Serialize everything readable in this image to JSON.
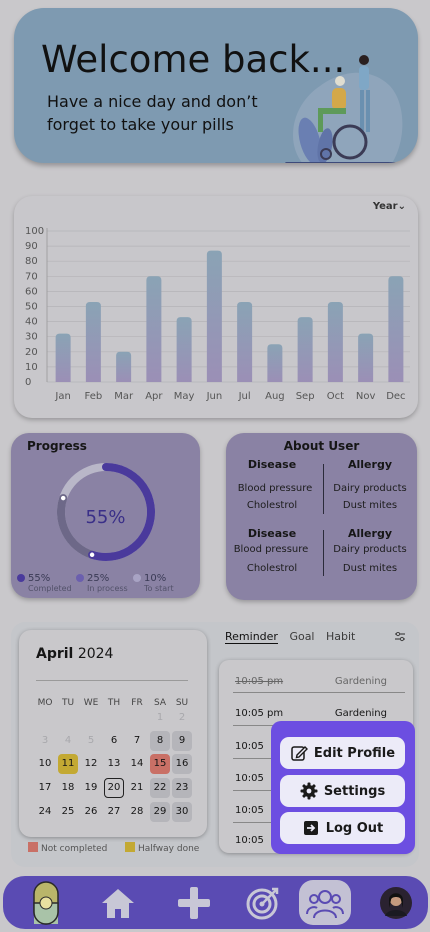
{
  "welcome": {
    "title": "Welcome back...",
    "subtitle": "Have a nice day and don’t forget to take your pills"
  },
  "chart": {
    "period_select": "Year",
    "period_select_icon": "chevron-down-icon"
  },
  "chart_data": {
    "type": "bar",
    "title": "",
    "xlabel": "",
    "ylabel": "",
    "categories": [
      "Jan",
      "Feb",
      "Mar",
      "Apr",
      "May",
      "Jun",
      "Jul",
      "Aug",
      "Sep",
      "Oct",
      "Nov",
      "Dec"
    ],
    "values": [
      32,
      53,
      20,
      70,
      43,
      87,
      53,
      25,
      43,
      53,
      32,
      70
    ],
    "ylim": [
      0,
      100
    ],
    "yticks": [
      0,
      10,
      20,
      30,
      40,
      50,
      60,
      70,
      80,
      90,
      100
    ],
    "grid": true,
    "bar_color_top": "#8aa3b5",
    "bar_color_bottom": "#9b8fb6"
  },
  "progress": {
    "title": "Progress",
    "percent_label": "55%",
    "completed_fraction": 0.55,
    "in_process_fraction": 0.25,
    "legend": [
      {
        "value": "55%",
        "label": "Completed",
        "color": "#4a3a9c"
      },
      {
        "value": "25%",
        "label": "In process",
        "color": "#6b5fae"
      },
      {
        "value": "10%",
        "label": "To start",
        "color": "#a8a3c4"
      }
    ]
  },
  "about": {
    "title": "About User",
    "disease_header": "Disease",
    "allergy_header": "Allergy",
    "groups": [
      {
        "disease": [
          "Blood pressure",
          "Cholestrol"
        ],
        "allergy": [
          "Dairy products",
          "Dust mites"
        ]
      },
      {
        "disease": [
          "Blood pressure",
          "Cholestrol"
        ],
        "allergy": [
          "Dairy products",
          "Dust mites"
        ]
      }
    ]
  },
  "calendar": {
    "month": "April",
    "year": "2024",
    "weekdays": [
      "MO",
      "TU",
      "WE",
      "TH",
      "FR",
      "SA",
      "SU"
    ],
    "weeks": [
      [
        "",
        "",
        "",
        "",
        "",
        "1",
        "2"
      ],
      [
        "3",
        "4",
        "5",
        "6",
        "7",
        "8",
        "9"
      ],
      [
        "10",
        "11",
        "12",
        "13",
        "14",
        "15",
        "16"
      ],
      [
        "17",
        "18",
        "19",
        "20",
        "21",
        "22",
        "23"
      ],
      [
        "24",
        "25",
        "26",
        "27",
        "28",
        "29",
        "30"
      ]
    ],
    "legend": [
      {
        "label": "Not completed",
        "color": "#c97066"
      },
      {
        "label": "Halfway done",
        "color": "#c3a933"
      }
    ]
  },
  "reminders": {
    "tabs": [
      "Reminder",
      "Goal",
      "Habit"
    ],
    "active_tab": "Reminder",
    "filter_icon": "filter-icon",
    "items": [
      {
        "time": "10:05 pm",
        "name": "Gardening",
        "done": true
      },
      {
        "time": "10:05 pm",
        "name": "Gardening",
        "done": false
      },
      {
        "time": "10:05",
        "name": "",
        "done": false
      },
      {
        "time": "10:05",
        "name": "",
        "done": false
      },
      {
        "time": "10:05",
        "name": "",
        "done": false
      },
      {
        "time": "10:05",
        "name": "",
        "done": false
      }
    ]
  },
  "popup": {
    "edit_profile": "Edit Profile",
    "settings": "Settings",
    "log_out": "Log Out",
    "accent": "#6c4ee1"
  },
  "nav": {
    "items": [
      "pill-icon",
      "home-icon",
      "plus-icon",
      "target-icon",
      "users-icon",
      "avatar"
    ],
    "active": "users-icon",
    "background": "#5a4bb3"
  }
}
